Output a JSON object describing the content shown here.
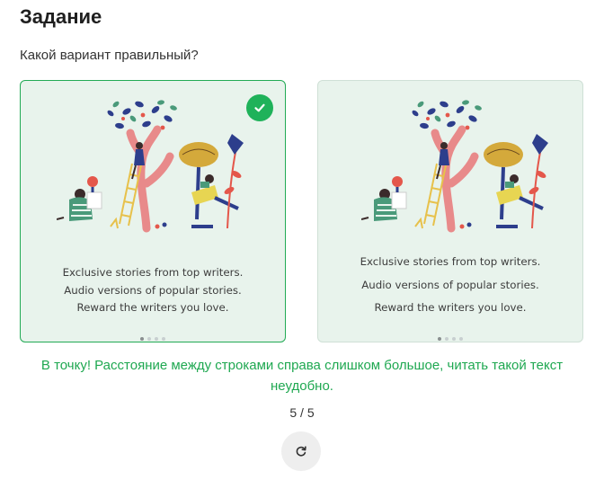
{
  "task": {
    "title": "Задание",
    "question": "Какой вариант правильный?"
  },
  "options": [
    {
      "caption_lines": [
        "Exclusive stories from top writers.",
        "Audio versions of popular stories.",
        "Reward the writers you love."
      ],
      "selected": true,
      "pager": {
        "total": 4,
        "active": 1
      }
    },
    {
      "caption_lines": [
        "Exclusive stories from top writers.",
        "Audio versions of popular stories.",
        "Reward the writers you love."
      ],
      "selected": false,
      "pager": {
        "total": 4,
        "active": 1
      }
    }
  ],
  "feedback": "В точку! Расстояние между строками справа слишком большое, читать такой текст неудобно.",
  "progress": "5 / 5",
  "colors": {
    "accent": "#1fb25a",
    "card_background": "#e8f3ec",
    "feedback_text": "#1fa851"
  },
  "icons": {
    "check": "check-icon",
    "retry": "refresh-icon"
  }
}
